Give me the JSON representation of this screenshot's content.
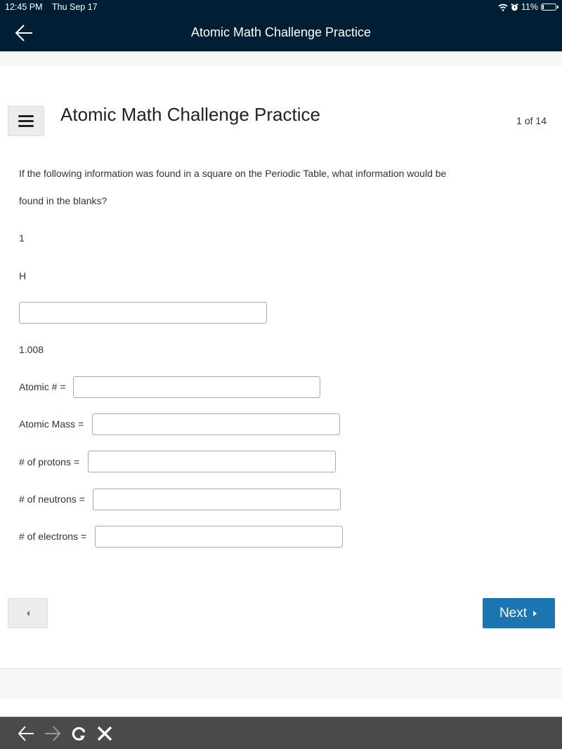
{
  "status_bar": {
    "time": "12:45 PM",
    "date": "Thu Sep 17",
    "battery": "11%",
    "icons": [
      "wifi-icon",
      "alarm-icon",
      "battery-icon"
    ]
  },
  "nav": {
    "back_icon": "back-arrow-icon",
    "title": "Atomic Math Challenge Practice"
  },
  "header": {
    "menu_icon": "hamburger-menu-icon",
    "title": "Atomic Math Challenge Practice",
    "page_count": "1 of 14"
  },
  "question": {
    "line1": "If the following information was found in a square on the Periodic Table, what information would be",
    "line2": "found in the blanks?",
    "element_number": "1",
    "element_symbol": "H",
    "name_blank_value": "",
    "element_mass": "1.008"
  },
  "fields": [
    {
      "label": "Atomic # =",
      "value": ""
    },
    {
      "label": "Atomic Mass =",
      "value": ""
    },
    {
      "label": "# of protons =",
      "value": ""
    },
    {
      "label": "# of neutrons =",
      "value": ""
    },
    {
      "label": "# of electrons =",
      "value": ""
    }
  ],
  "navigation": {
    "prev_icon": "caret-left-icon",
    "next_label": "Next",
    "next_icon": "caret-right-icon"
  },
  "browser_toolbar": {
    "icons": [
      "back-icon",
      "forward-icon",
      "reload-icon",
      "close-icon"
    ]
  },
  "colors": {
    "topbar": "#001f35",
    "next_button": "#1a75b0",
    "browser_bar": "#4a4a4a"
  }
}
